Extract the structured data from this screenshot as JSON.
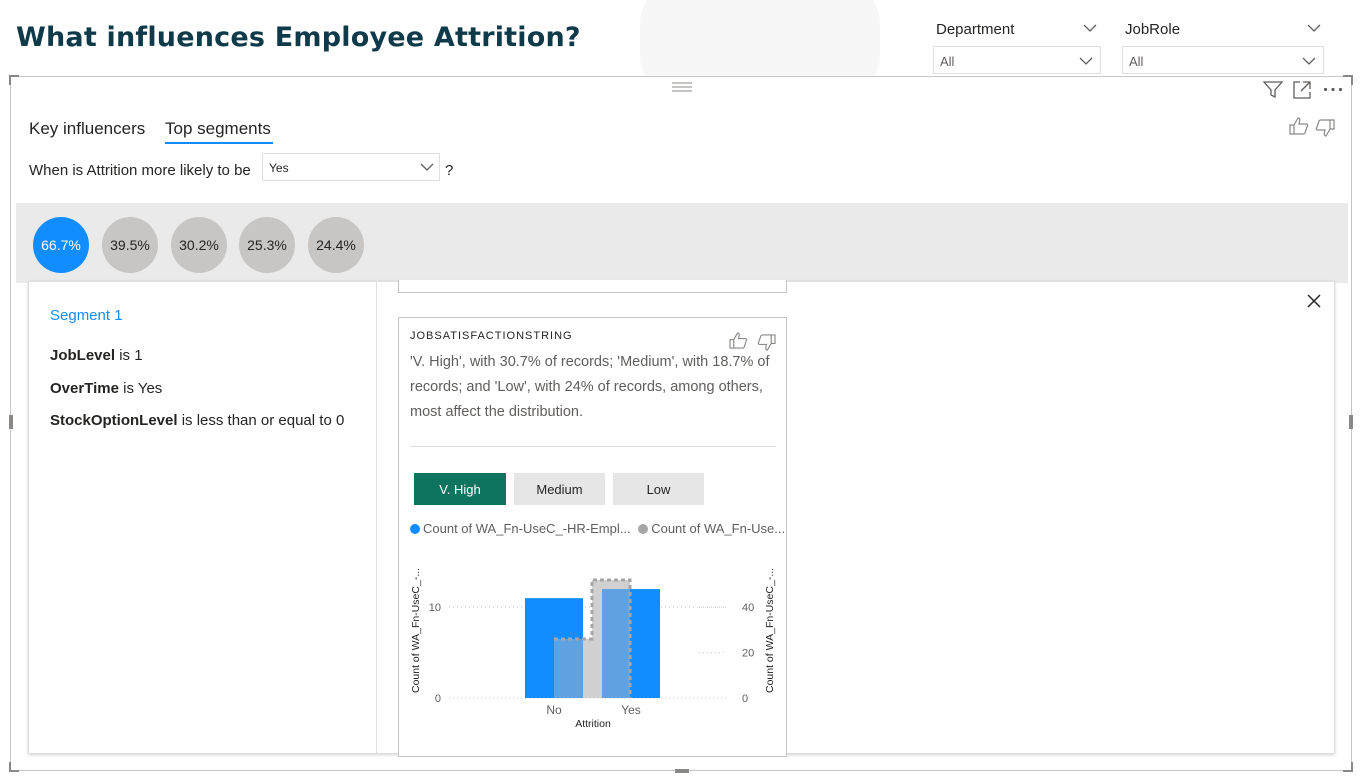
{
  "page": {
    "title": "What influences Employee Attrition?"
  },
  "slicers": [
    {
      "label": "Department",
      "value": "All"
    },
    {
      "label": "JobRole",
      "value": "All"
    }
  ],
  "tabs": [
    {
      "label": "Key influencers",
      "active": false
    },
    {
      "label": "Top segments",
      "active": true
    }
  ],
  "question": {
    "prefix": "When is Attrition more likely to be",
    "value": "Yes",
    "suffix": "?"
  },
  "segments": [
    "66.7%",
    "39.5%",
    "30.2%",
    "25.3%",
    "24.4%"
  ],
  "segment_detail": {
    "title": "Segment 1",
    "conditions": [
      {
        "field": "JobLevel",
        "rest": " is 1"
      },
      {
        "field": "OverTime",
        "rest": " is Yes"
      },
      {
        "field": "StockOptionLevel",
        "rest": " is less than or equal to 0"
      }
    ]
  },
  "card": {
    "header": "JOBSATISFACTIONSTRING",
    "description": "'V. High', with 30.7% of records; 'Medium', with 18.7% of records; and 'Low', with 24% of records, among others, most affect the distribution.",
    "buttons": [
      {
        "label": "V. High",
        "active": true
      },
      {
        "label": "Medium",
        "active": false
      },
      {
        "label": "Low",
        "active": false
      }
    ],
    "legend": [
      {
        "label": "Count of WA_Fn-UseC_-HR-Empl...",
        "color": "#118dff"
      },
      {
        "label": "Count of WA_Fn-Use...",
        "color": "#a6a6a6"
      }
    ]
  },
  "chart_data": {
    "type": "bar",
    "categories": [
      "No",
      "Yes"
    ],
    "xlabel": "Attrition",
    "ylabel_left": "Count of WA_Fn-UseC_-...",
    "ylabel_right": "Count of WA_Fn-UseC_-...",
    "left_axis": {
      "ticks": [
        0,
        10
      ],
      "ylim": [
        0,
        13
      ]
    },
    "right_axis": {
      "ticks": [
        0,
        20,
        40
      ],
      "ylim": [
        0,
        52
      ]
    },
    "series": [
      {
        "name": "Count of WA_Fn-UseC_-HR-Empl...",
        "axis": "left",
        "values": [
          11,
          12
        ],
        "color": "#118dff"
      },
      {
        "name": "Count of WA_Fn-Use...",
        "axis": "right",
        "values": [
          26,
          52
        ],
        "color": "#a6a6a6"
      }
    ]
  }
}
